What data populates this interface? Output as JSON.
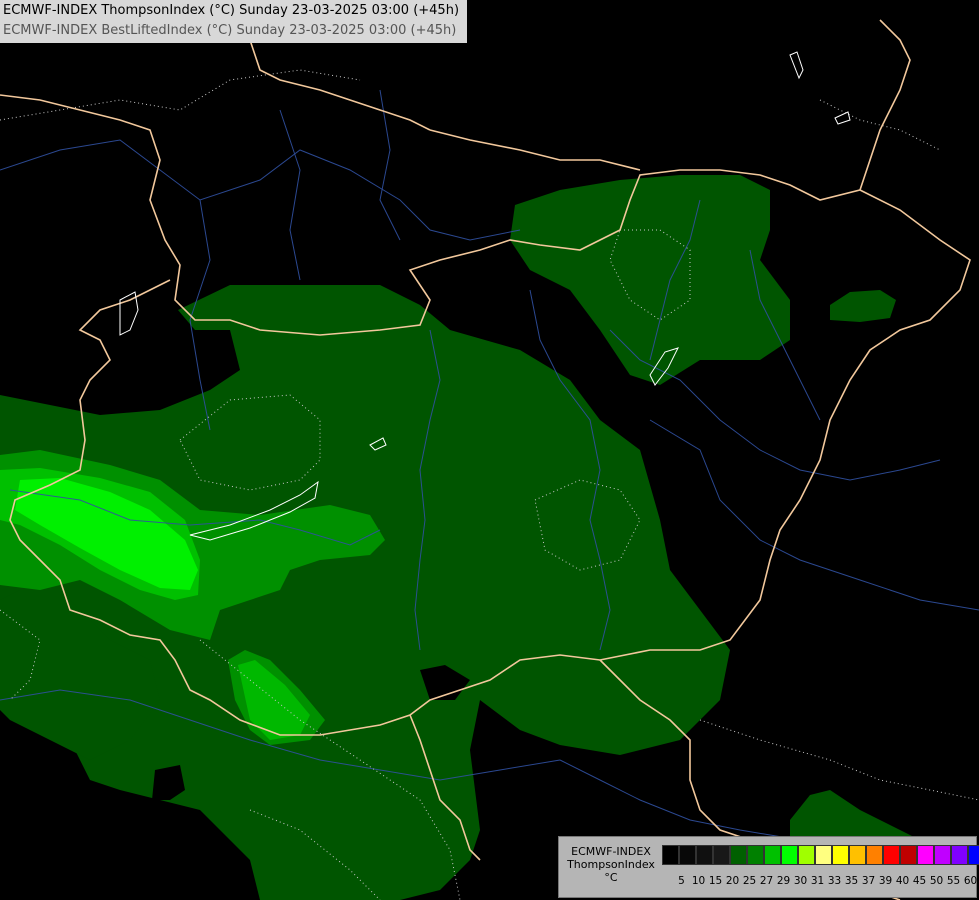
{
  "header": {
    "line1": "ECMWF-INDEX ThompsonIndex (°C) Sunday 23-03-2025 03:00 (+45h)",
    "line2": "ECMWF-INDEX BestLiftedIndex (°C) Sunday 23-03-2025 03:00 (+45h)"
  },
  "legend": {
    "model": "ECMWF-INDEX",
    "parameter": "ThompsonIndex",
    "unit": "°C",
    "colors": [
      "#000000",
      "#080808",
      "#101010",
      "#181818",
      "#006000",
      "#008000",
      "#00c000",
      "#00ff00",
      "#a0ff00",
      "#ffff80",
      "#ffff00",
      "#ffc000",
      "#ff8000",
      "#ff0000",
      "#c00000",
      "#ff00ff",
      "#c000ff",
      "#8000ff",
      "#0000ff"
    ],
    "ticks": [
      "5",
      "10",
      "15",
      "20",
      "25",
      "27",
      "29",
      "30",
      "31",
      "33",
      "35",
      "37",
      "39",
      "40",
      "45",
      "50",
      "55",
      "60"
    ]
  },
  "map": {
    "icons": [
      "border-lines",
      "river-lines",
      "lifted-index-contours"
    ]
  }
}
